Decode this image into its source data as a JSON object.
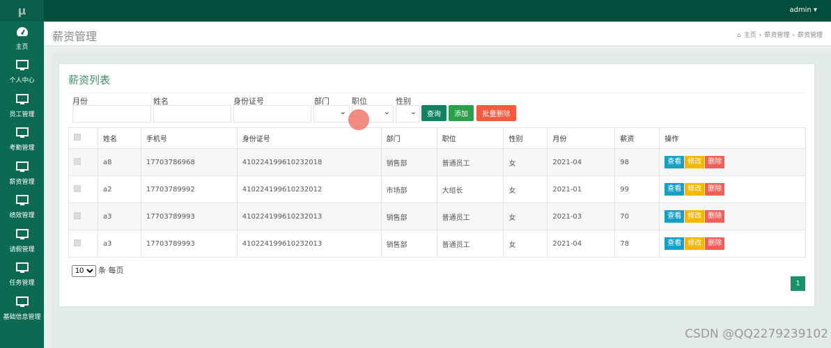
{
  "logo": "μ",
  "sidebar": {
    "items": [
      {
        "label": "主页",
        "icon": "dashboard-icon"
      },
      {
        "label": "个人中心",
        "icon": "monitor-icon"
      },
      {
        "label": "员工管理",
        "icon": "monitor-icon"
      },
      {
        "label": "考勤管理",
        "icon": "monitor-icon"
      },
      {
        "label": "薪资管理",
        "icon": "monitor-icon"
      },
      {
        "label": "绩效管理",
        "icon": "monitor-icon"
      },
      {
        "label": "请假管理",
        "icon": "monitor-icon"
      },
      {
        "label": "任务管理",
        "icon": "monitor-icon"
      },
      {
        "label": "基础信息管理",
        "icon": "monitor-icon"
      }
    ]
  },
  "topbar": {
    "user": "admin ▾"
  },
  "header": {
    "title": "薪资管理",
    "breadcrumb": [
      "主页",
      "薪资管理",
      "薪资管理"
    ]
  },
  "card": {
    "title": "薪资列表"
  },
  "filters": {
    "month": "月份",
    "name": "姓名",
    "id": "身份证号",
    "dept": "部门",
    "position": "职位",
    "gender": "性别"
  },
  "buttons": {
    "search": "查询",
    "add": "添加",
    "batch_delete": "批量删除"
  },
  "table": {
    "headers": [
      "姓名",
      "手机号",
      "身份证号",
      "部门",
      "职位",
      "性别",
      "月份",
      "薪资",
      "操作"
    ],
    "rows": [
      [
        "a8",
        "17703786968",
        "410224199610232018",
        "销售部",
        "普通员工",
        "女",
        "2021-04",
        "98"
      ],
      [
        "a2",
        "17703789992",
        "410224199610232012",
        "市场部",
        "大组长",
        "女",
        "2021-01",
        "99"
      ],
      [
        "a3",
        "17703789993",
        "410224199610232013",
        "销售部",
        "普通员工",
        "女",
        "2021-03",
        "70"
      ],
      [
        "a3",
        "17703789993",
        "410224199610232013",
        "销售部",
        "普通员工",
        "女",
        "2021-04",
        "78"
      ]
    ],
    "actions": [
      "查看",
      "修改",
      "删除"
    ]
  },
  "pager": {
    "size": "10",
    "suffix": "条 每页",
    "current": "1"
  },
  "watermark": "CSDN @QQ2279239102",
  "colors": {
    "sidebar": "#0c6a53",
    "topbar": "#034d3c",
    "view": "#1a9fc4",
    "edit": "#f5b800",
    "delete": "#f0605a",
    "search": "#138260",
    "add": "#2aa04a",
    "batch": "#f55a3f"
  }
}
